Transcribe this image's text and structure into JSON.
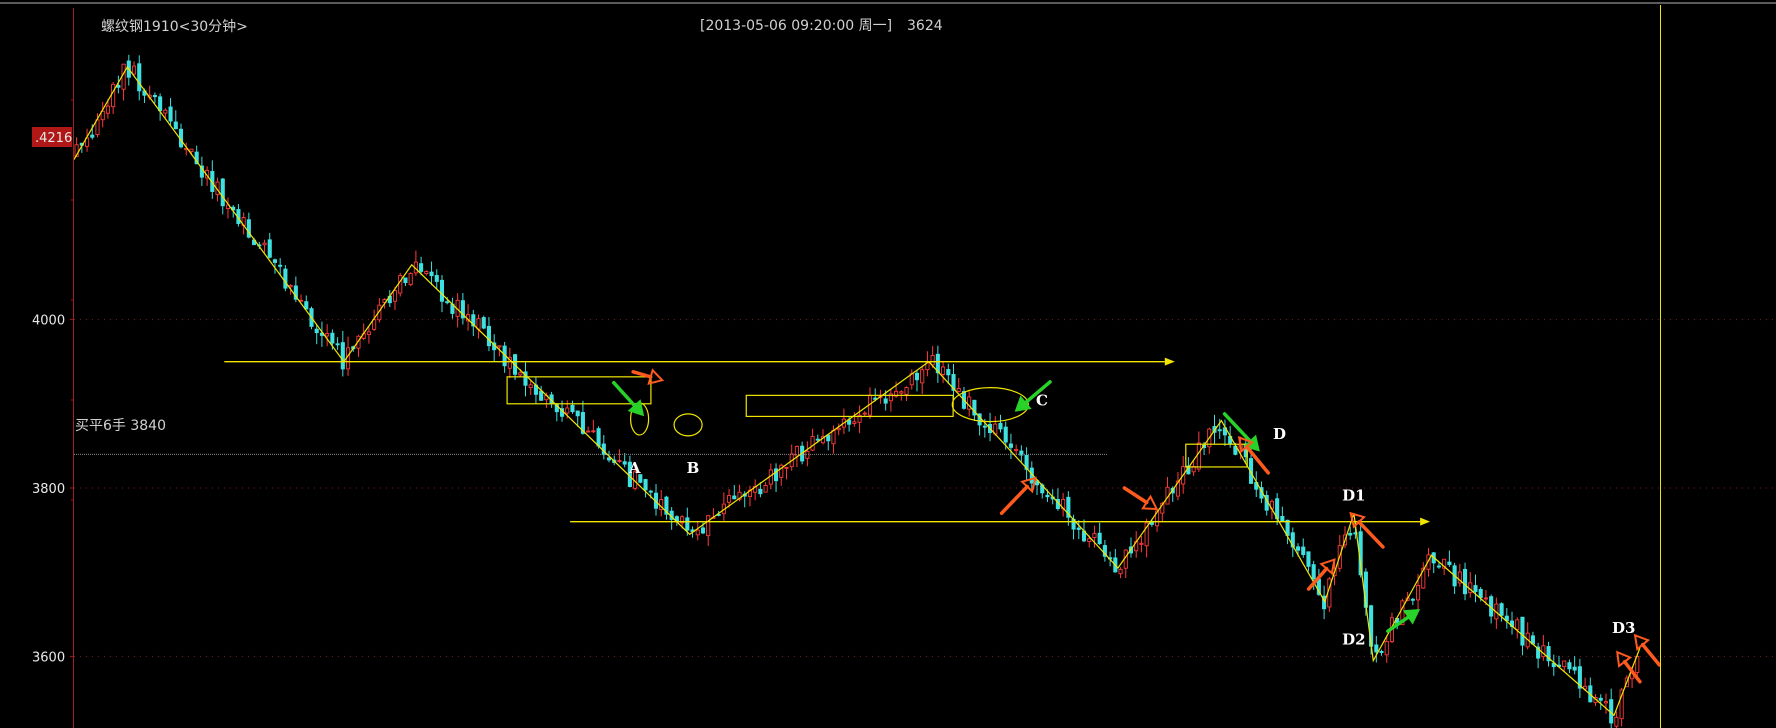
{
  "header": {
    "symbol": "螺纹钢1910<30分钟>",
    "datetime": "[2013-05-06  09:20:00 周一]",
    "value": "3624"
  },
  "colors": {
    "background": "#000000",
    "up": "#ff3b3b",
    "down": "#3fe0e0",
    "trend": "#f2e600",
    "position_line": "#8a8a8a",
    "price_tag": "#b01818",
    "arrow_orange": "#ff5a1e",
    "arrow_green": "#28d228",
    "axis": "#a02020"
  },
  "chart_data": {
    "type": "candlestick",
    "ylim": [
      3515,
      4370
    ],
    "yticks": [
      3600,
      3800,
      4000
    ],
    "grid": true,
    "current_price_tag": ".4216",
    "current_price": 4216,
    "position_line": {
      "text": "买平6手 3840",
      "price": 3840
    },
    "zigzag": [
      {
        "x": 0.0,
        "price": 4190
      },
      {
        "x": 3.3,
        "price": 4300
      },
      {
        "x": 16.7,
        "price": 3950
      },
      {
        "x": 20.9,
        "price": 4065
      },
      {
        "x": 38.1,
        "price": 3745
      },
      {
        "x": 52.9,
        "price": 3950
      },
      {
        "x": 64.6,
        "price": 3705
      },
      {
        "x": 71.0,
        "price": 3880
      },
      {
        "x": 77.4,
        "price": 3665
      },
      {
        "x": 79.2,
        "price": 3770
      },
      {
        "x": 80.4,
        "price": 3595
      },
      {
        "x": 84.0,
        "price": 3720
      },
      {
        "x": 95.3,
        "price": 3530
      },
      {
        "x": 96.9,
        "price": 3610
      }
    ],
    "horizontal_lines": [
      {
        "x1": 9.3,
        "x2": 67.5,
        "price": 3950,
        "arrow": true
      },
      {
        "x1": 30.7,
        "x2": 83.3,
        "price": 3760,
        "arrow": true
      }
    ],
    "boxes": [
      {
        "x1": 26.8,
        "x2": 35.7,
        "p_hi": 3932,
        "p_lo": 3900
      },
      {
        "x1": 41.6,
        "x2": 54.4,
        "p_hi": 3910,
        "p_lo": 3885
      },
      {
        "x1": 68.8,
        "x2": 72.6,
        "p_hi": 3852,
        "p_lo": 3825
      }
    ],
    "ellipses": [
      {
        "x": 35.0,
        "price": 3882,
        "rx": 9,
        "ry": 16
      },
      {
        "x": 38.0,
        "price": 3875,
        "rx": 14,
        "ry": 11
      },
      {
        "x": 56.7,
        "price": 3899,
        "rx": 38,
        "ry": 17
      }
    ],
    "labels": [
      {
        "text": "A",
        "x": 34.7,
        "price": 3818
      },
      {
        "text": "B",
        "x": 38.3,
        "price": 3818
      },
      {
        "text": "C",
        "x": 59.9,
        "price": 3898
      },
      {
        "text": "D",
        "x": 74.6,
        "price": 3858
      },
      {
        "text": "D1",
        "x": 79.2,
        "price": 3785
      },
      {
        "text": "D2",
        "x": 79.2,
        "price": 3614
      },
      {
        "text": "D3",
        "x": 95.9,
        "price": 3628
      }
    ],
    "arrows": [
      {
        "color": "green",
        "x1": 33.4,
        "p1": 3925,
        "x2": 35.2,
        "p2": 3887
      },
      {
        "color": "orange",
        "x1": 34.6,
        "p1": 3938,
        "x2": 36.4,
        "p2": 3928
      },
      {
        "color": "green",
        "x1": 60.4,
        "p1": 3926,
        "x2": 58.3,
        "p2": 3892
      },
      {
        "color": "orange",
        "x1": 57.4,
        "p1": 3770,
        "x2": 59.5,
        "p2": 3812
      },
      {
        "color": "orange",
        "x1": 65.0,
        "p1": 3800,
        "x2": 67.0,
        "p2": 3775
      },
      {
        "color": "green",
        "x1": 71.2,
        "p1": 3888,
        "x2": 73.3,
        "p2": 3845
      },
      {
        "color": "orange",
        "x1": 73.9,
        "p1": 3818,
        "x2": 72.1,
        "p2": 3860
      },
      {
        "color": "orange",
        "x1": 76.4,
        "p1": 3680,
        "x2": 78.0,
        "p2": 3715
      },
      {
        "color": "orange",
        "x1": 81.0,
        "p1": 3730,
        "x2": 79.0,
        "p2": 3770
      },
      {
        "color": "green",
        "x1": 81.3,
        "p1": 3630,
        "x2": 83.2,
        "p2": 3655
      },
      {
        "color": "orange",
        "x1": 96.9,
        "p1": 3570,
        "x2": 95.5,
        "p2": 3605
      },
      {
        "color": "orange",
        "x1": 98.1,
        "p1": 3590,
        "x2": 96.6,
        "p2": 3625
      }
    ]
  }
}
